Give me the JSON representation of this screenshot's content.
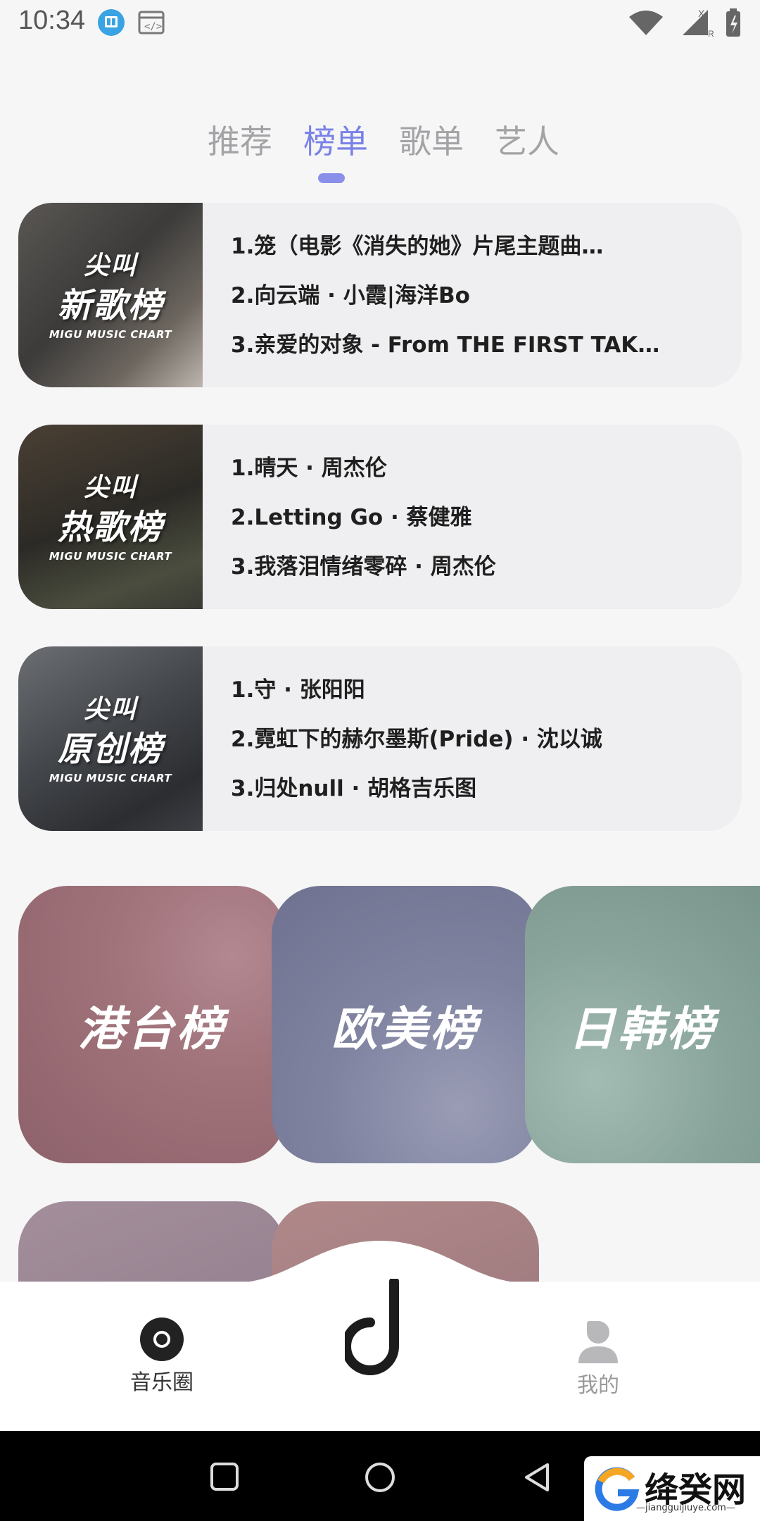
{
  "status_bar": {
    "time": "10:34"
  },
  "tabs": [
    {
      "label": "推荐",
      "active": false
    },
    {
      "label": "榜单",
      "active": true
    },
    {
      "label": "歌单",
      "active": false
    },
    {
      "label": "艺人",
      "active": false
    }
  ],
  "charts": [
    {
      "cover_line1": "尖叫",
      "cover_line2": "新歌榜",
      "cover_subtitle": "MIGU MUSIC CHART",
      "songs": [
        "1.笼（电影《消失的她》片尾主题曲…",
        "2.向云端 · 小霞|海洋Bo",
        "3.亲爱的对象 - From THE FIRST TAK…"
      ]
    },
    {
      "cover_line1": "尖叫",
      "cover_line2": "热歌榜",
      "cover_subtitle": "MIGU MUSIC CHART",
      "songs": [
        "1.晴天 · 周杰伦",
        "2.Letting Go · 蔡健雅",
        "3.我落泪情绪零碎 · 周杰伦"
      ]
    },
    {
      "cover_line1": "尖叫",
      "cover_line2": "原创榜",
      "cover_subtitle": "MIGU MUSIC CHART",
      "songs": [
        "1.守 · 张阳阳",
        "2.霓虹下的赫尔墨斯(Pride) · 沈以诚",
        "3.归处null · 胡格吉乐图"
      ]
    }
  ],
  "regions": [
    {
      "label": "港台榜",
      "color": "#a0727a"
    },
    {
      "label": "欧美榜",
      "color": "#7f83a0"
    },
    {
      "label": "日韩榜",
      "color": "#8aa59c"
    }
  ],
  "bottom_nav": {
    "left_label": "音乐圈",
    "right_label": "我的"
  },
  "watermark": {
    "text": "绛癸网",
    "url": "—jiangguijiuye.com—"
  }
}
